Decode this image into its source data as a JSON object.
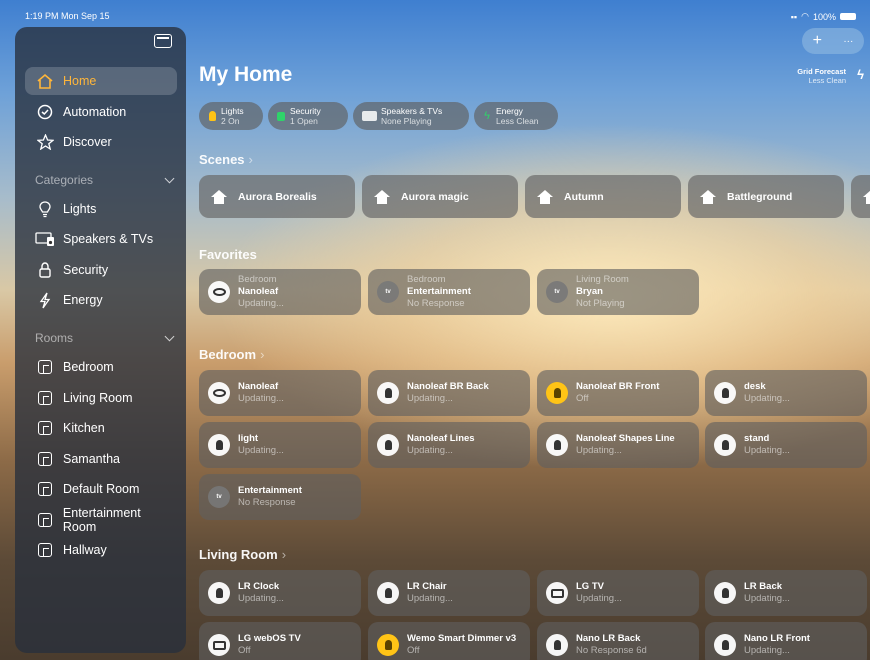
{
  "status": {
    "time": "1:19 PM  Mon Sep 15",
    "battery": "100%"
  },
  "sidebar": {
    "items": [
      {
        "label": "Home"
      },
      {
        "label": "Automation"
      },
      {
        "label": "Discover"
      }
    ],
    "categories_label": "Categories",
    "categories": [
      {
        "label": "Lights"
      },
      {
        "label": "Speakers & TVs"
      },
      {
        "label": "Security"
      },
      {
        "label": "Energy"
      }
    ],
    "rooms_label": "Rooms",
    "rooms": [
      {
        "label": "Bedroom"
      },
      {
        "label": "Living Room"
      },
      {
        "label": "Kitchen"
      },
      {
        "label": "Samantha"
      },
      {
        "label": "Default Room"
      },
      {
        "label": "Entertainment Room"
      },
      {
        "label": "Hallway"
      }
    ]
  },
  "header": {
    "title": "My Home",
    "add": "+",
    "more": "···",
    "grid_forecast": {
      "title": "Grid Forecast",
      "status": "Less Clean"
    }
  },
  "pills": [
    {
      "title": "Lights",
      "sub": "2 On"
    },
    {
      "title": "Security",
      "sub": "1 Open"
    },
    {
      "title": "Speakers & TVs",
      "sub": "None Playing"
    },
    {
      "title": "Energy",
      "sub": "Less Clean"
    }
  ],
  "scenes_label": "Scenes",
  "scenes": [
    "Aurora Borealis",
    "Aurora magic",
    "Autumn",
    "Battleground"
  ],
  "favorites_label": "Favorites",
  "favorites": [
    {
      "room": "Bedroom",
      "name": "Nanoleaf",
      "status": "Updating..."
    },
    {
      "room": "Bedroom",
      "name": "Entertainment",
      "status": "No Response"
    },
    {
      "room": "Living Room",
      "name": "Bryan",
      "status": "Not Playing"
    }
  ],
  "bedroom_label": "Bedroom",
  "bedroom": [
    {
      "name": "Nanoleaf",
      "status": "Updating..."
    },
    {
      "name": "Nanoleaf BR Back",
      "status": "Updating..."
    },
    {
      "name": "Nanoleaf BR Front",
      "status": "Off"
    },
    {
      "name": "desk",
      "status": "Updating..."
    },
    {
      "name": "light",
      "status": "Updating..."
    },
    {
      "name": "Nanoleaf Lines",
      "status": "Updating..."
    },
    {
      "name": "Nanoleaf Shapes Line",
      "status": "Updating..."
    },
    {
      "name": "stand",
      "status": "Updating..."
    },
    {
      "name": "Entertainment",
      "status": "No Response"
    }
  ],
  "living_label": "Living Room",
  "living": [
    {
      "name": "LR Clock",
      "status": "Updating..."
    },
    {
      "name": "LR Chair",
      "status": "Updating..."
    },
    {
      "name": "LG TV",
      "status": "Updating..."
    },
    {
      "name": "LR Back",
      "status": "Updating..."
    },
    {
      "name": "LG webOS TV",
      "status": "Off"
    },
    {
      "name": "Wemo Smart Dimmer v3",
      "status": "Off"
    },
    {
      "name": "Nano LR Back",
      "status": "No Response 6d"
    },
    {
      "name": "Nano LR Front",
      "status": "Updating..."
    }
  ],
  "colors": {
    "accent": "#ffb63a",
    "bulb_on": "#ffc416"
  },
  "tv_badge": "tv"
}
